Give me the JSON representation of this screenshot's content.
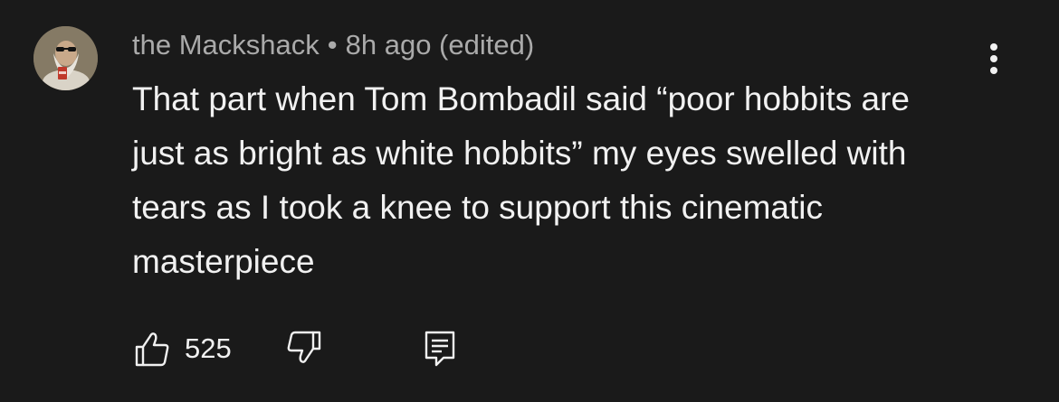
{
  "comment": {
    "author": "the Mackshack",
    "separator": "•",
    "timestamp": "8h ago (edited)",
    "text": "That part when Tom Bombadil said “poor hobbits are just as bright as white hobbits” my eyes swelled with tears as I took a knee to support this cinematic masterpiece",
    "like_count": "525"
  },
  "icons": {
    "avatar": "avatar-image",
    "more": "more-vertical-icon",
    "like": "thumbs-up-icon",
    "dislike": "thumbs-down-icon",
    "reply": "reply-comment-icon"
  },
  "colors": {
    "background": "#1a1a1a",
    "primary_text": "#f1f1f1",
    "secondary_text": "#aaaaaa"
  }
}
